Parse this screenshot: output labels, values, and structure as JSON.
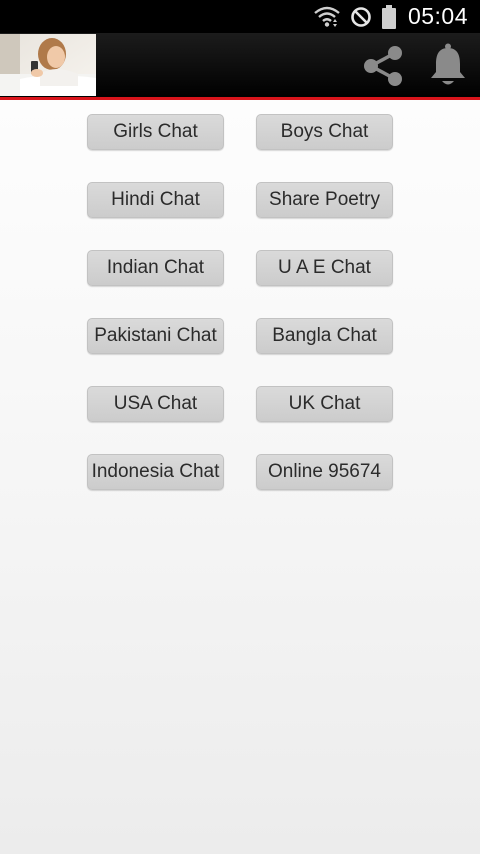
{
  "status_bar": {
    "time": "05:04",
    "icons": [
      "wifi-icon",
      "do-not-disturb-icon",
      "battery-icon"
    ]
  },
  "app_bar": {
    "avatar_icon": "profile-photo",
    "share_icon": "share-icon",
    "notification_icon": "bell-icon",
    "accent_color": "#d9141b"
  },
  "buttons": [
    {
      "label": "Girls Chat"
    },
    {
      "label": "Boys Chat"
    },
    {
      "label": "Hindi Chat"
    },
    {
      "label": "Share Poetry"
    },
    {
      "label": "Indian Chat"
    },
    {
      "label": "U A E Chat"
    },
    {
      "label": "Pakistani Chat"
    },
    {
      "label": "Bangla Chat"
    },
    {
      "label": "USA Chat"
    },
    {
      "label": "UK Chat"
    },
    {
      "label": "Indonesia Chat"
    },
    {
      "label": "Online 95674"
    }
  ]
}
